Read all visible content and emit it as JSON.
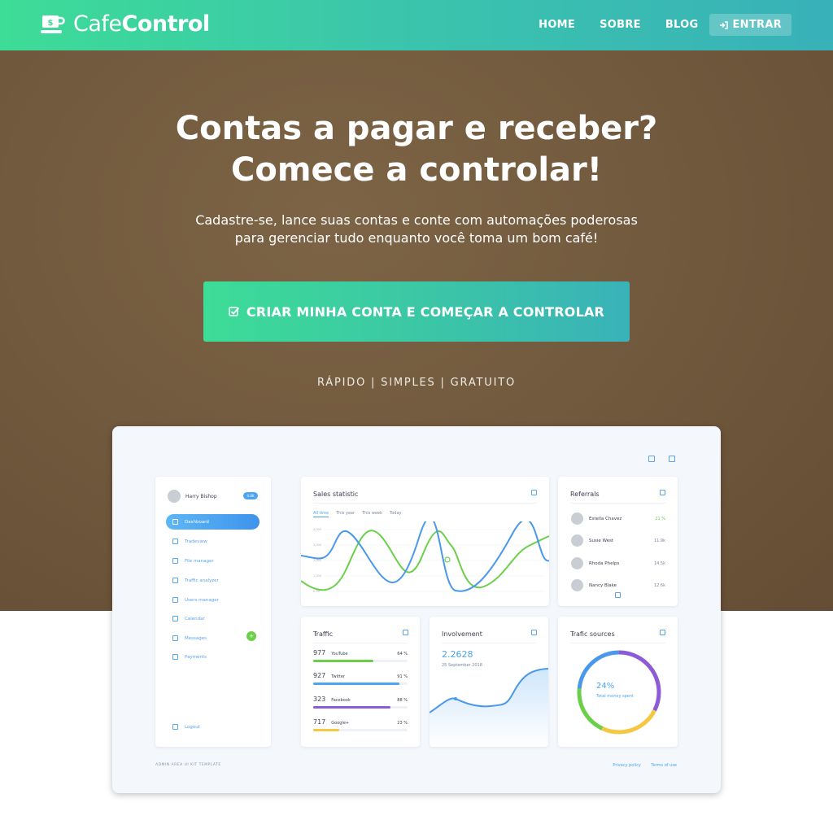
{
  "header": {
    "brand_light": "Cafe",
    "brand_bold": "Control",
    "nav": [
      "HOME",
      "SOBRE",
      "BLOG"
    ],
    "login_label": "ENTRAR"
  },
  "hero": {
    "headline_line1": "Contas a pagar e receber?",
    "headline_line2": "Comece a controlar!",
    "sub_line1": "Cadastre-se, lance suas contas e conte com automações poderosas",
    "sub_line2": "para gerenciar tudo enquanto você toma um bom café!",
    "cta_label": "CRIAR MINHA CONTA E COMEÇAR A CONTROLAR",
    "tagline": "RÁPIDO | SIMPLES | GRATUITO"
  },
  "mockup": {
    "user": {
      "name": "Harry Bishop",
      "badge": "4.8K"
    },
    "menu": [
      "Dashboard",
      "Tradeview",
      "File manager",
      "Traffic analyzer",
      "Users manager",
      "Calendar",
      "Messages",
      "Payments"
    ],
    "messages_count": "+",
    "logout_label": "Logout",
    "sales": {
      "title": "Sales statistic",
      "tabs": [
        "All time",
        "This year",
        "This week",
        "Today"
      ],
      "ticks": [
        "4,000",
        "3,000",
        "2,000",
        "1,000",
        "0,00"
      ]
    },
    "referrals": {
      "title": "Referrals",
      "items": [
        {
          "name": "Estella Chavez",
          "value": "21 %"
        },
        {
          "name": "Susie West",
          "value": "11.9k"
        },
        {
          "name": "Rhoda Phelps",
          "value": "14.5k"
        },
        {
          "name": "Nancy Blake",
          "value": "12.6k"
        }
      ]
    },
    "traffic": {
      "title": "Traffic",
      "rows": [
        {
          "count": "977",
          "source": "YouTube",
          "percent": "64 %",
          "level": 0.64,
          "color": "#6ccf4a"
        },
        {
          "count": "927",
          "source": "Twitter",
          "percent": "91 %",
          "level": 0.91,
          "color": "#4da4f0"
        },
        {
          "count": "323",
          "source": "Facebook",
          "percent": "88 %",
          "level": 0.82,
          "color": "#8e5bd6"
        },
        {
          "count": "717",
          "source": "Google+",
          "percent": "23 %",
          "level": 0.28,
          "color": "#f4c842"
        }
      ]
    },
    "involvement": {
      "title": "Involvement",
      "value": "2.2628",
      "date": "25 September 2018"
    },
    "traffic_sources": {
      "title": "Trafic sources",
      "value": "24%",
      "subtitle": "Total money spent"
    },
    "footer": {
      "left": "ADMIN AREA UI KIT TEMPLATE",
      "links": [
        "Privacy policy",
        "Terms of use"
      ]
    }
  },
  "colors": {
    "accent_green": "#3ddc97",
    "accent_teal": "#38b1b8",
    "hero_brown": "#725a3e",
    "ui_blue": "#4da4f0"
  }
}
